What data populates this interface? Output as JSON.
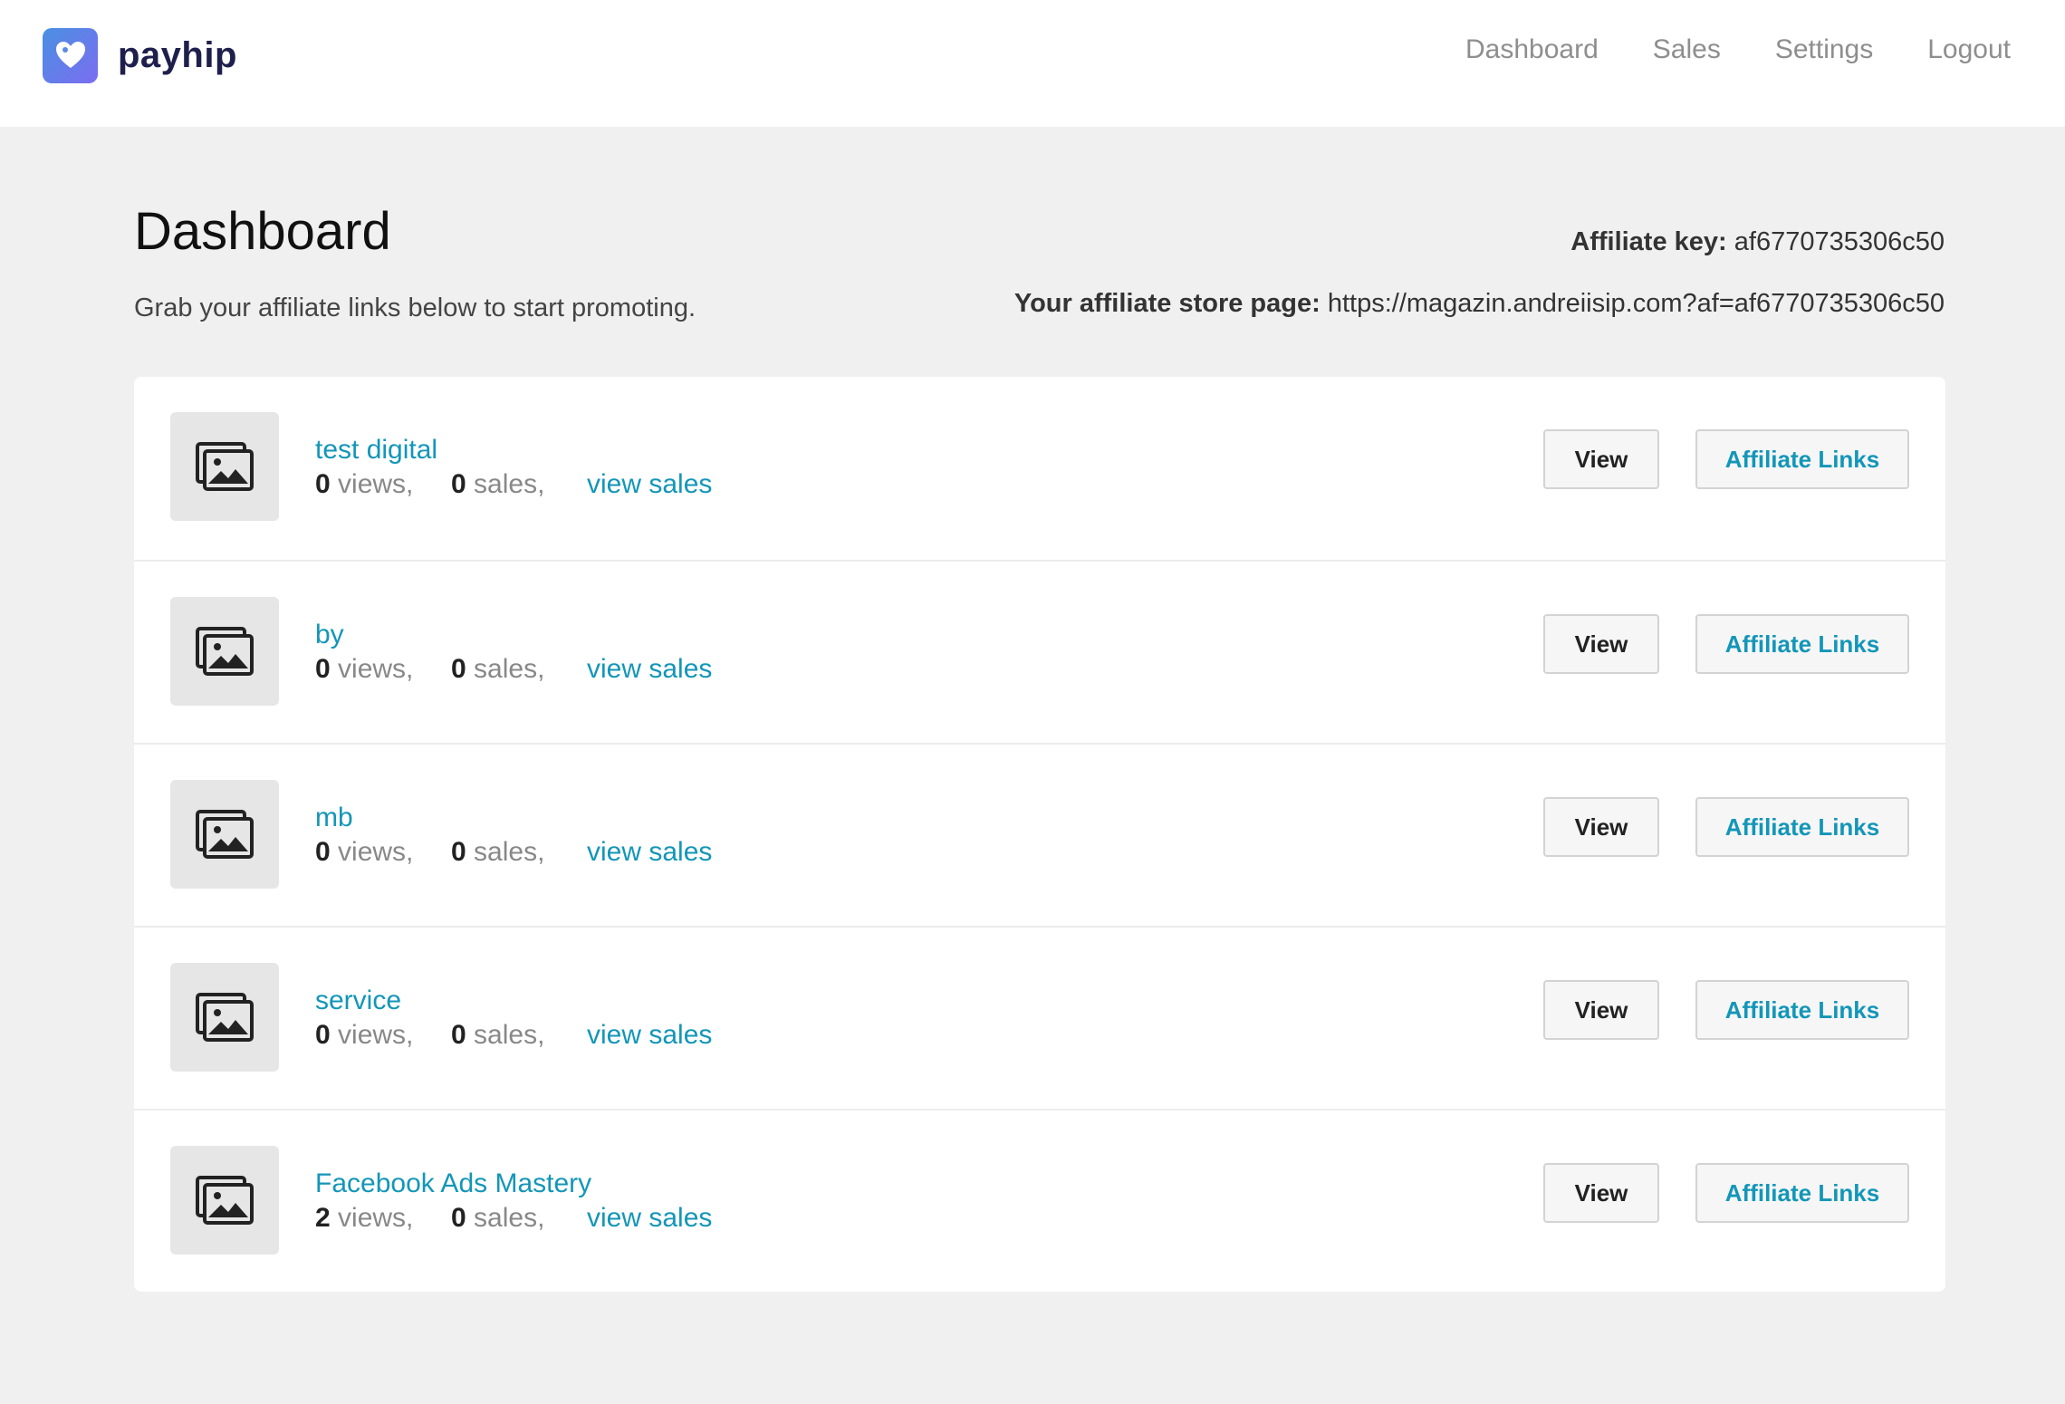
{
  "header": {
    "brand": "payhip",
    "nav": [
      "Dashboard",
      "Sales",
      "Settings",
      "Logout"
    ]
  },
  "page": {
    "title": "Dashboard",
    "subtitle": "Grab your affiliate links below to start promoting.",
    "affiliate_key_label": "Affiliate key:",
    "affiliate_key": "af6770735306c50",
    "store_page_label": "Your affiliate store page:",
    "store_page_url": "https://magazin.andreiisip.com?af=af6770735306c50"
  },
  "products": [
    {
      "title": "test digital",
      "views": "0",
      "views_label": "views,",
      "sales": "0",
      "sales_label": "sales,",
      "link": "view sales",
      "view_btn": "View",
      "aff_btn": "Affiliate Links"
    },
    {
      "title": "by",
      "views": "0",
      "views_label": "views,",
      "sales": "0",
      "sales_label": "sales,",
      "link": "view sales",
      "view_btn": "View",
      "aff_btn": "Affiliate Links"
    },
    {
      "title": "mb",
      "views": "0",
      "views_label": "views,",
      "sales": "0",
      "sales_label": "sales,",
      "link": "view sales",
      "view_btn": "View",
      "aff_btn": "Affiliate Links"
    },
    {
      "title": "service",
      "views": "0",
      "views_label": "views,",
      "sales": "0",
      "sales_label": "sales,",
      "link": "view sales",
      "view_btn": "View",
      "aff_btn": "Affiliate Links"
    },
    {
      "title": "Facebook Ads Mastery",
      "views": "2",
      "views_label": "views,",
      "sales": "0",
      "sales_label": "sales,",
      "link": "view sales",
      "view_btn": "View",
      "aff_btn": "Affiliate Links"
    }
  ],
  "icons": {
    "logo": "heart-tag-icon",
    "thumbnail": "image-placeholder-icon"
  },
  "colors": {
    "link": "#1396b8",
    "brand_text": "#1f1f4d",
    "background": "#f0f0f0"
  }
}
